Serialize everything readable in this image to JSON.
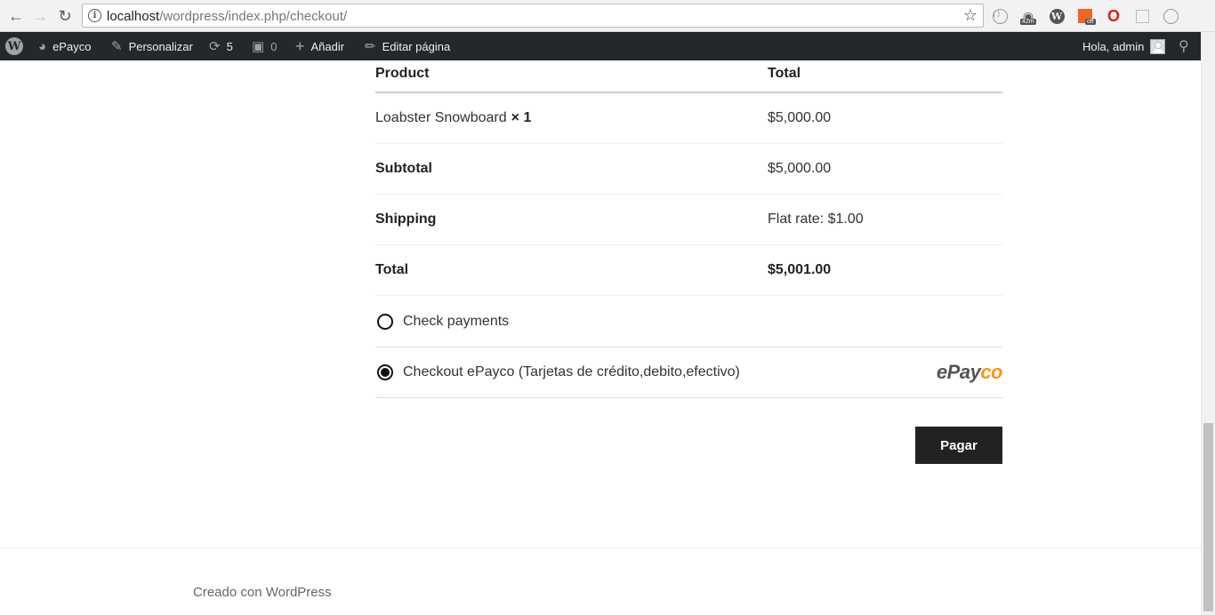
{
  "browser": {
    "url_host": "localhost",
    "url_path": "/wordpress/index.php/checkout/",
    "ext_badges": {
      "timer": "42m",
      "off": "off"
    }
  },
  "adminbar": {
    "site": "ePayco",
    "customize": "Personalizar",
    "updates_count": "5",
    "comments_count": "0",
    "new": "Añadir",
    "edit": "Editar página",
    "greeting": "Hola, admin"
  },
  "order": {
    "header": {
      "product": "Product",
      "total": "Total"
    },
    "items": [
      {
        "name": "Loabster Snowboard",
        "qty": "× 1",
        "total": "$5,000.00"
      }
    ],
    "subtotal": {
      "label": "Subtotal",
      "value": "$5,000.00"
    },
    "shipping": {
      "label": "Shipping",
      "value": "Flat rate: $1.00"
    },
    "total": {
      "label": "Total",
      "value": "$5,001.00"
    }
  },
  "payments": [
    {
      "label": "Check payments",
      "selected": false
    },
    {
      "label": "Checkout ePayco (Tarjetas de crédito,debito,efectivo)",
      "selected": true,
      "logo_a": "ePay",
      "logo_b": "co"
    }
  ],
  "actions": {
    "pay": "Pagar"
  },
  "footer": {
    "credit": "Creado con WordPress"
  },
  "colors": {
    "adminbar": "#23282d",
    "button": "#222222",
    "epayco_orange": "#f7941d"
  }
}
